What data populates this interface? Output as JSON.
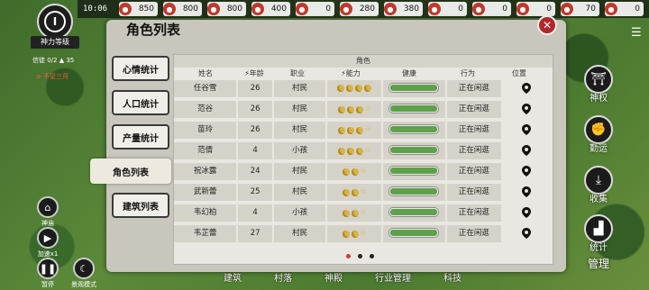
{
  "time": "10:06",
  "resources": [
    {
      "icon": "food-icon",
      "value": "850"
    },
    {
      "icon": "meat-icon",
      "value": "800"
    },
    {
      "icon": "grain-icon",
      "value": "800"
    },
    {
      "icon": "wood-icon",
      "value": "400"
    },
    {
      "icon": "stone-icon",
      "value": "0"
    },
    {
      "icon": "iron-icon",
      "value": "280"
    },
    {
      "icon": "tool-icon",
      "value": "380"
    },
    {
      "icon": "cloth-icon",
      "value": "0"
    },
    {
      "icon": "herb-icon",
      "value": "0"
    },
    {
      "icon": "coin-icon",
      "value": "0"
    },
    {
      "icon": "gem-icon",
      "value": "70"
    },
    {
      "icon": "medicine-icon",
      "value": "0"
    }
  ],
  "hud": {
    "level_badge": "I",
    "level_label": "神力等级",
    "stat_line": "信徒 0/2  ▲ 35",
    "warning": "≡ 不足三月"
  },
  "left_buttons": [
    {
      "icon": "home-icon",
      "label": "神庙"
    },
    {
      "icon": "play-icon",
      "label": "加速x1"
    },
    {
      "icon": "pause-icon",
      "label": "暂停"
    },
    {
      "icon": "moon-mode-icon",
      "label": "景观模式"
    }
  ],
  "right_buttons": [
    {
      "icon": "temple-icon",
      "label": "神权"
    },
    {
      "icon": "fist-icon",
      "label": "勤运"
    },
    {
      "icon": "gather-icon",
      "label": "收集"
    },
    {
      "icon": "chart-icon",
      "label": "统计"
    },
    {
      "icon": "manage-icon",
      "label": "管理"
    }
  ],
  "bottom_nav": [
    "建筑",
    "村落",
    "神殿",
    "行业管理",
    "科技"
  ],
  "panel": {
    "title": "角色列表",
    "group_header": "角色",
    "tabs": [
      "心情统计",
      "人口统计",
      "产量统计",
      "角色列表",
      "建筑列表"
    ],
    "columns": [
      "姓名",
      "⚡年龄",
      "职业",
      "⚡能力",
      "健康",
      "行为",
      "位置"
    ],
    "rows": [
      {
        "name": "任谷雪",
        "age": "26",
        "job": "村民",
        "ability": 4,
        "half": false,
        "health": 1.0,
        "action": "正在闲逛"
      },
      {
        "name": "范谷",
        "age": "26",
        "job": "村民",
        "ability": 3,
        "half": true,
        "health": 1.0,
        "action": "正在闲逛"
      },
      {
        "name": "苗玲",
        "age": "26",
        "job": "村民",
        "ability": 3,
        "half": true,
        "health": 1.0,
        "action": "正在闲逛"
      },
      {
        "name": "范倩",
        "age": "4",
        "job": "小孩",
        "ability": 3,
        "half": true,
        "health": 1.0,
        "action": "正在闲逛"
      },
      {
        "name": "祝冰露",
        "age": "24",
        "job": "村民",
        "ability": 2,
        "half": true,
        "health": 1.0,
        "action": "正在闲逛"
      },
      {
        "name": "武新蕾",
        "age": "25",
        "job": "村民",
        "ability": 2,
        "half": true,
        "health": 1.0,
        "action": "正在闲逛"
      },
      {
        "name": "韦幻柏",
        "age": "4",
        "job": "小孩",
        "ability": 2,
        "half": true,
        "health": 1.0,
        "action": "正在闲逛"
      },
      {
        "name": "韦芷蕾",
        "age": "27",
        "job": "村民",
        "ability": 2,
        "half": true,
        "health": 1.0,
        "action": "正在闲逛"
      }
    ],
    "page": 1,
    "pages": 3
  }
}
